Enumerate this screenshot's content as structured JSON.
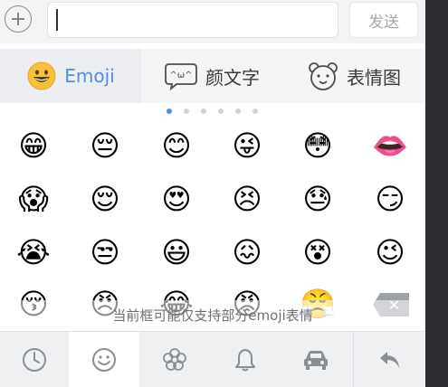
{
  "input_bar": {
    "send_label": "发送"
  },
  "tabs": [
    {
      "label": "Emoji",
      "icon": "grinning-face-icon",
      "active": true
    },
    {
      "label": "颜文字",
      "icon": "kaomoji-bubble-icon",
      "active": false
    },
    {
      "label": "表情图",
      "icon": "bear-face-icon",
      "active": false
    }
  ],
  "page_indicator": {
    "pages": 6,
    "current": 1
  },
  "emoji_rows": [
    [
      "😁",
      "😔",
      "😊",
      "😜",
      "😳",
      "👄"
    ],
    [
      "😱",
      "😌",
      "😍",
      "😣",
      "😓",
      "😏"
    ],
    [
      "😭",
      "😒",
      "😃",
      "😖",
      "😵",
      "😉"
    ],
    [
      "😚",
      "😠",
      "😂",
      "😡",
      "😤",
      ""
    ]
  ],
  "notice": "当前框可能仅支持部分emoji表情",
  "bottom_bar": [
    "recent-clock-icon",
    "smiley-icon",
    "flower-icon",
    "bell-icon",
    "car-icon",
    "return-arrow-icon"
  ],
  "colors": {
    "accent": "#4a90e2",
    "icon_gray": "#8a8d92"
  }
}
